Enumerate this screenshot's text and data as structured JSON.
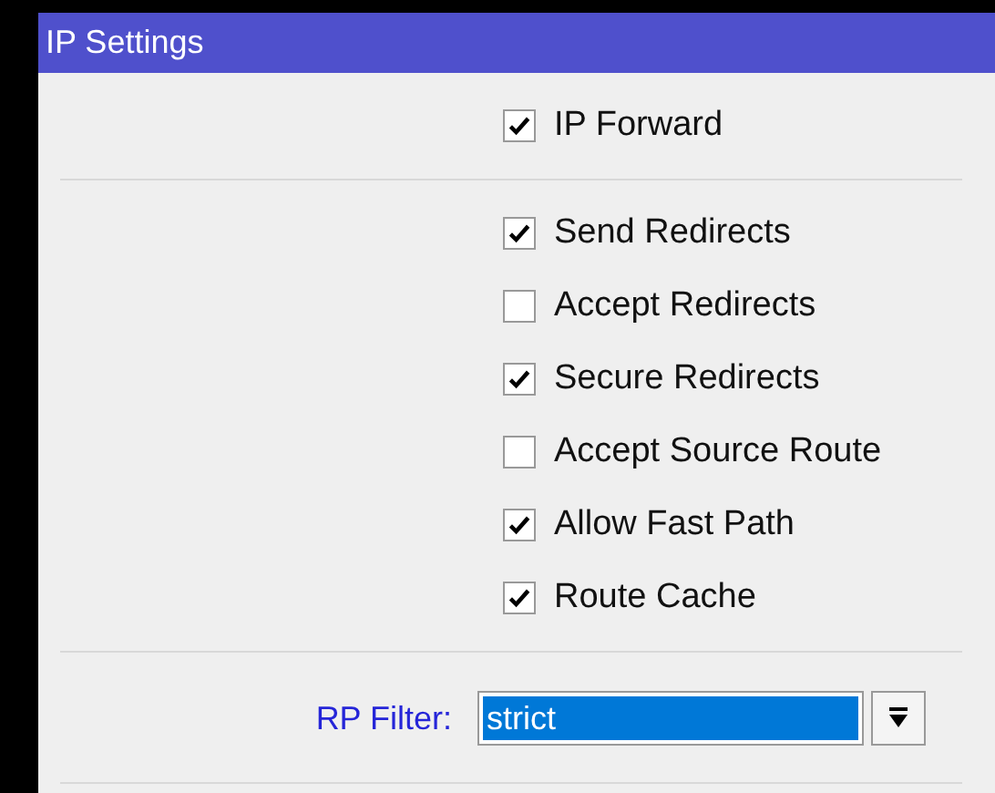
{
  "window": {
    "title": "IP Settings"
  },
  "sections": [
    {
      "checkboxes": [
        {
          "label": "IP Forward",
          "checked": true
        }
      ]
    },
    {
      "checkboxes": [
        {
          "label": "Send Redirects",
          "checked": true
        },
        {
          "label": "Accept Redirects",
          "checked": false
        },
        {
          "label": "Secure Redirects",
          "checked": true
        },
        {
          "label": "Accept Source Route",
          "checked": false
        },
        {
          "label": "Allow Fast Path",
          "checked": true
        },
        {
          "label": "Route Cache",
          "checked": true
        }
      ]
    }
  ],
  "rp_filter": {
    "label": "RP Filter:",
    "value": "strict",
    "selected": true
  }
}
